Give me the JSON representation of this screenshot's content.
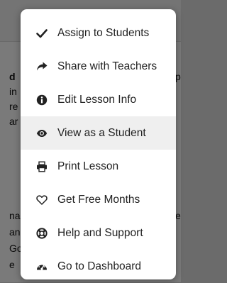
{
  "menu": {
    "items": [
      {
        "label": "Assign to Students",
        "icon": "checkmark-icon"
      },
      {
        "label": "Share with Teachers",
        "icon": "share-arrow-icon"
      },
      {
        "label": "Edit Lesson Info",
        "icon": "info-circle-icon"
      },
      {
        "label": "View as a Student",
        "icon": "eye-icon"
      },
      {
        "label": "Print Lesson",
        "icon": "printer-icon"
      },
      {
        "label": "Get Free Months",
        "icon": "heart-icon"
      },
      {
        "label": "Help and Support",
        "icon": "lifebuoy-icon"
      },
      {
        "label": "Go to Dashboard",
        "icon": "dashboard-gauge-icon"
      }
    ],
    "highlighted_index": 3
  },
  "background": {
    "fragments": [
      "d",
      "in",
      "re",
      "ar",
      "p",
      "na",
      "an",
      "Go",
      "e",
      "e"
    ]
  },
  "colors": {
    "menu_bg": "#ffffff",
    "hover_bg": "#efefef",
    "text": "#222222",
    "overlay": "rgba(0,0,0,0.52)"
  }
}
